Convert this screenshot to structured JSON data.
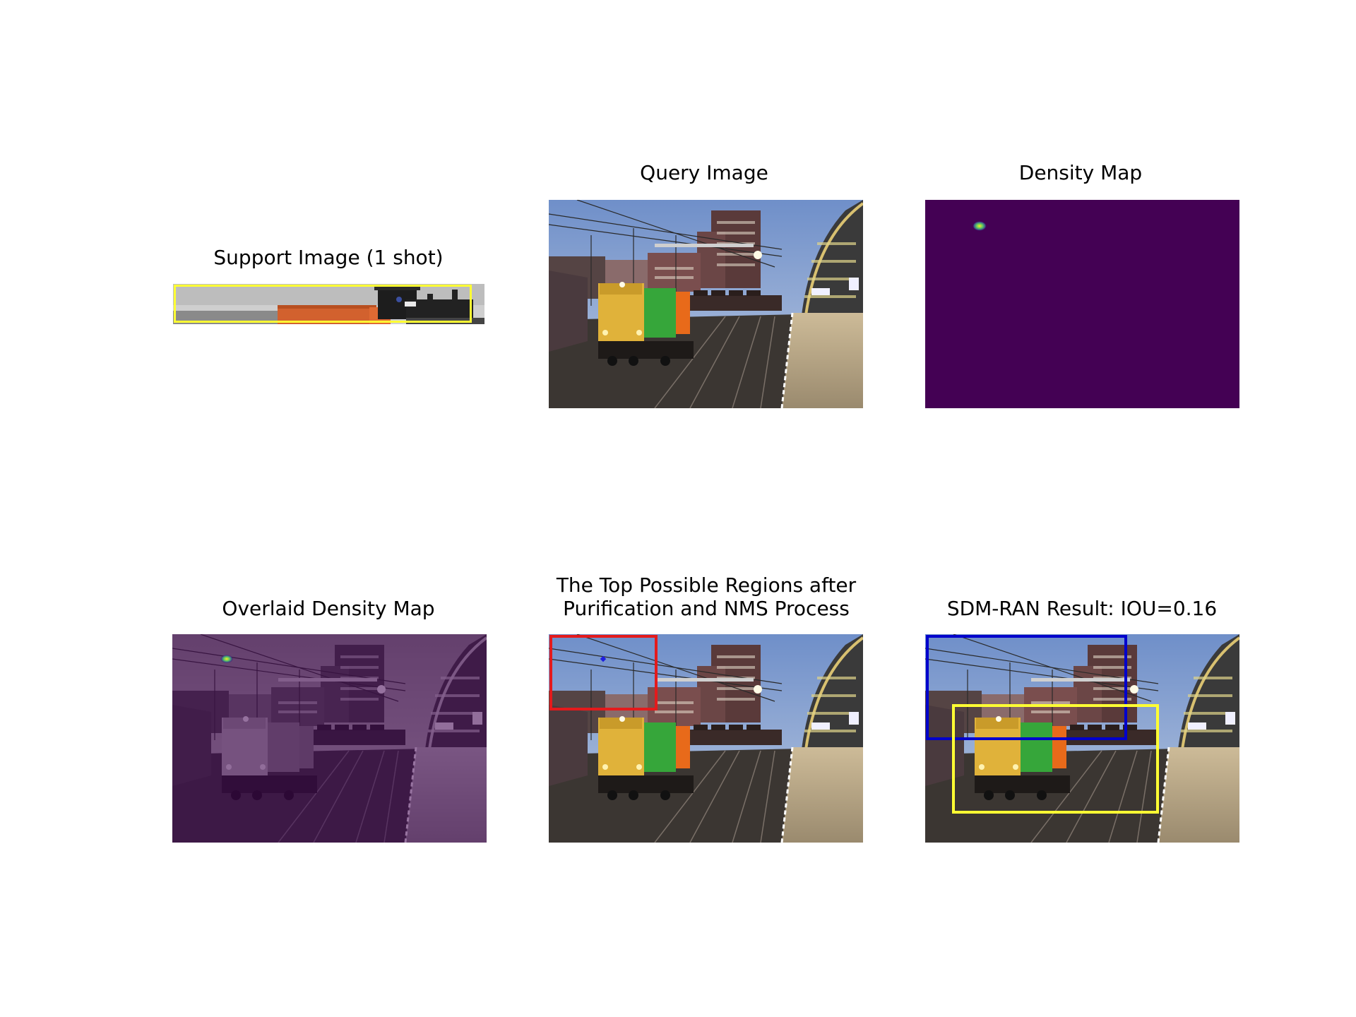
{
  "figure": {
    "support_title": "Support Image (1 shot)",
    "query_title": "Query Image",
    "density_title": "Density Map",
    "overlay_title": "Overlaid Density Map",
    "regions_title_line1": "The Top Possible Regions after",
    "regions_title_line2": "Purification and NMS Process",
    "result_title": "SDM-RAN Result: IOU=0.16"
  },
  "colors": {
    "density_background": "#440154",
    "support_box": "#ffff33",
    "region_box": "#e41a1c",
    "predicted_box": "#0000cc",
    "ground_truth_box": "#ffff33"
  }
}
